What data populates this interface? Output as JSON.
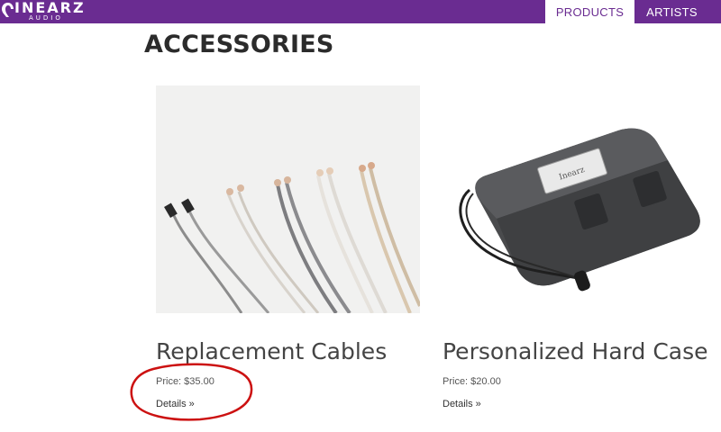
{
  "header": {
    "logo_text": "INEARZ",
    "logo_sub": "AUDIO",
    "nav": [
      "PRODUCTS",
      "ARTISTS"
    ]
  },
  "main": {
    "title": "ACCESSORIES",
    "products": [
      {
        "name": "Replacement Cables",
        "price": "Price: $35.00",
        "details": "Details »",
        "image_icon": "cables-photo"
      },
      {
        "name": "Personalized Hard Case",
        "price": "Price: $20.00",
        "details": "Details »",
        "image_icon": "hard-case-photo"
      }
    ]
  },
  "case_label": "Inearz",
  "colors": {
    "brand": "#6a2c91",
    "annotation": "#cc1111"
  }
}
